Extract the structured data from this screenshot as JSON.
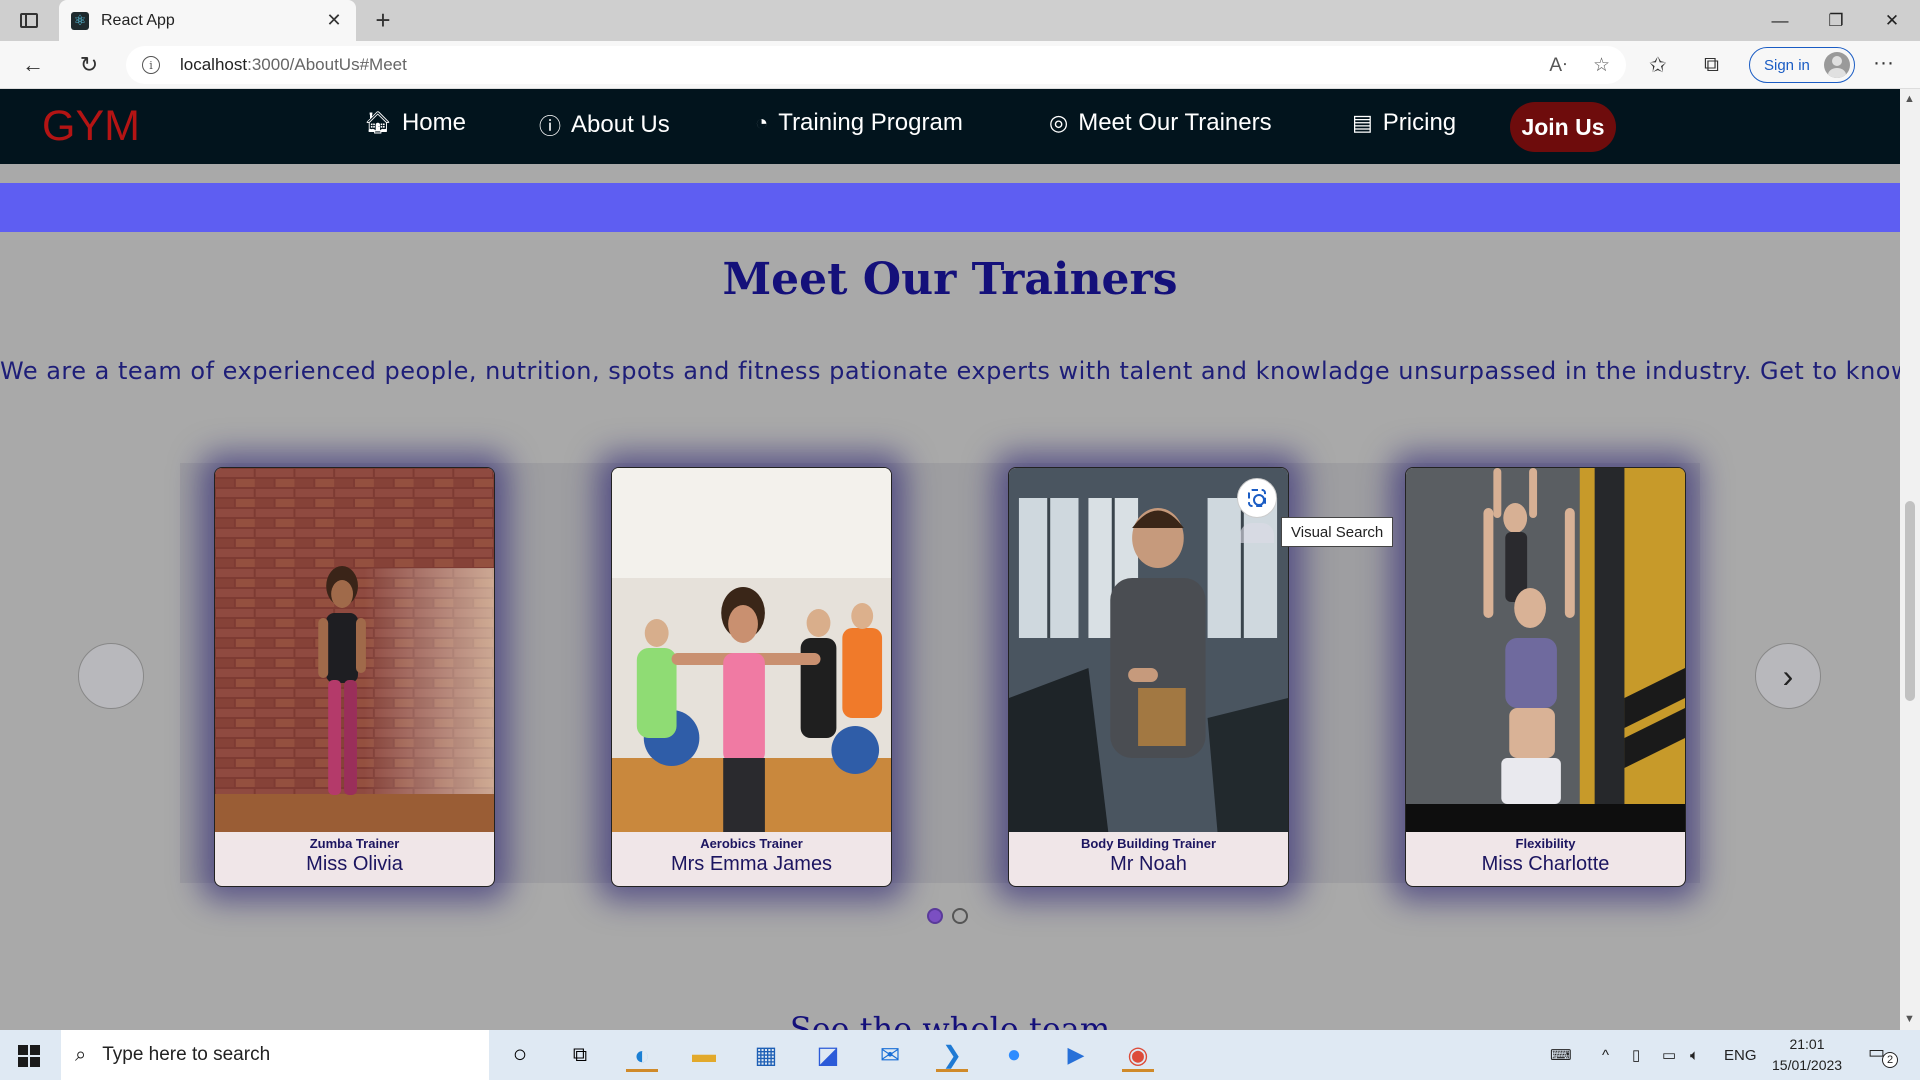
{
  "browser": {
    "tab_title": "React App",
    "url_host": "localhost",
    "url_path": ":3000/AboutUs#Meet",
    "signin_label": "Sign in"
  },
  "site": {
    "logo": "GYM",
    "nav": {
      "home": "Home",
      "about": "About Us",
      "training": "Training Program",
      "trainers": "Meet Our Trainers",
      "pricing": "Pricing",
      "join": "Join Us"
    }
  },
  "section": {
    "title": "Meet Our Trainers",
    "description": "We are a team of experienced people, nutrition, spots and fitness pationate experts with talent and knowladge unsurpassed in the industry. Get to know us.",
    "see_team": "See the whole team"
  },
  "trainers": [
    {
      "role": "Zumba Trainer",
      "name": "Miss Olivia"
    },
    {
      "role": "Aerobics Trainer",
      "name": "Mrs Emma James"
    },
    {
      "role": "Body Building Trainer",
      "name": "Mr Noah"
    },
    {
      "role": "Flexibility",
      "name": "Miss Charlotte"
    }
  ],
  "carousel": {
    "page_count": 2,
    "active_page": 1
  },
  "overlay": {
    "tooltip": "Visual Search"
  },
  "taskbar": {
    "search_placeholder": "Type here to search",
    "language": "ENG",
    "time": "21:01",
    "date": "15/01/2023",
    "notification_count": "2"
  }
}
